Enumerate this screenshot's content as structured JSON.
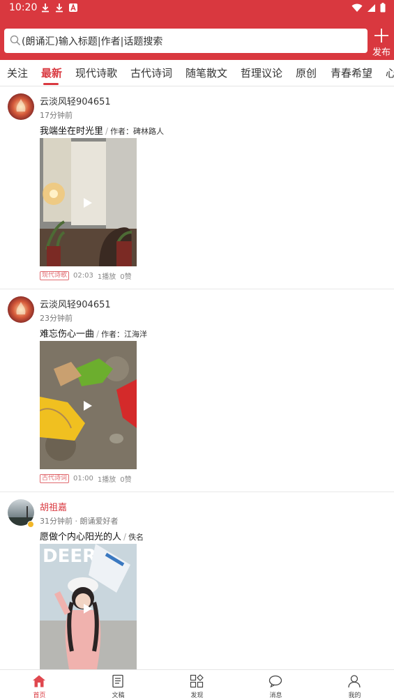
{
  "status_bar": {
    "time": "10:20"
  },
  "search": {
    "placeholder_text": "(朗诵汇)输入标题|作者|话题搜索"
  },
  "publish": {
    "label": "发布"
  },
  "tabs": [
    {
      "label": "关注"
    },
    {
      "label": "最新",
      "active": true
    },
    {
      "label": "现代诗歌"
    },
    {
      "label": "古代诗词"
    },
    {
      "label": "随笔散文"
    },
    {
      "label": "哲理议论"
    },
    {
      "label": "原创"
    },
    {
      "label": "青春希望"
    },
    {
      "label": "心"
    }
  ],
  "posts": [
    {
      "author": "云淡风轻904651",
      "meta": "17分钟前",
      "title": "我端坐在时光里",
      "separator": "/",
      "by": "作者：碑林路人",
      "tag": "现代诗歌",
      "duration": "02:03",
      "plays": "1播放",
      "likes": "0赞"
    },
    {
      "author": "云淡风轻904651",
      "meta": "23分钟前",
      "title": "难忘伤心一曲",
      "separator": "/",
      "by": "作者：江海洋",
      "tag": "古代诗词",
      "duration": "01:00",
      "plays": "1播放",
      "likes": "0赞"
    },
    {
      "author": "胡祖嘉",
      "meta": "31分钟前 · 朗诵爱好者",
      "title": "愿做个内心阳光的人",
      "separator": "/",
      "by": "佚名",
      "thumb_text": "DEER"
    }
  ],
  "bottom_nav": [
    {
      "label": "首页",
      "icon": "home-icon",
      "active": true
    },
    {
      "label": "文稿",
      "icon": "document-icon"
    },
    {
      "label": "发现",
      "icon": "discover-icon"
    },
    {
      "label": "消息",
      "icon": "message-icon"
    },
    {
      "label": "我的",
      "icon": "profile-icon"
    }
  ],
  "colors": {
    "accent": "#d9383f",
    "tag": "#e06a6f"
  }
}
